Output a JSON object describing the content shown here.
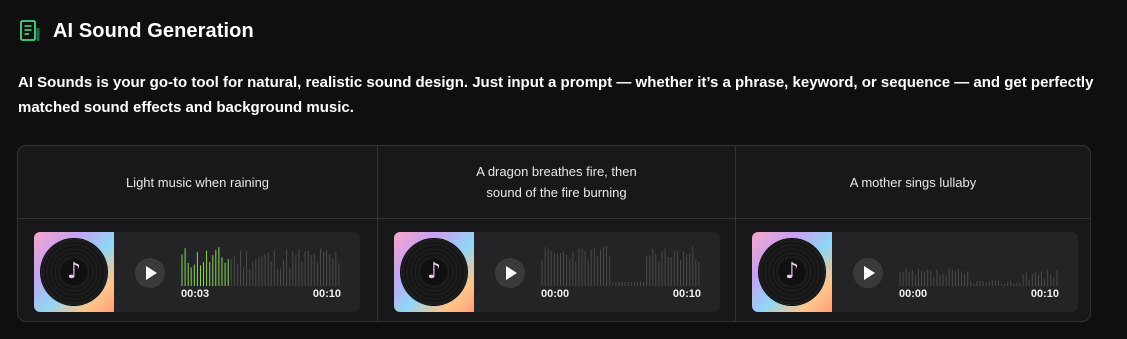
{
  "header": {
    "title": "AI Sound Generation",
    "icon": "document-icon",
    "accent": "#3ddc84"
  },
  "description": "AI Sounds is your go-to tool for natural, realistic sound design. Just input a prompt — whether it’s a phrase, keyword, or sequence — and get perfectly matched sound effects and background music.",
  "samples": [
    {
      "prompt": "Light music when raining",
      "current_time": "00:03",
      "total_time": "00:10",
      "progress": 0.3
    },
    {
      "prompt": "A dragon breathes fire, then sound of the fire burning",
      "current_time": "00:00",
      "total_time": "00:10",
      "progress": 0
    },
    {
      "prompt": "A mother sings lullaby",
      "current_time": "00:00",
      "total_time": "00:10",
      "progress": 0
    }
  ],
  "colors": {
    "played": "#86d654",
    "unplayed": "#4a4a4c"
  }
}
